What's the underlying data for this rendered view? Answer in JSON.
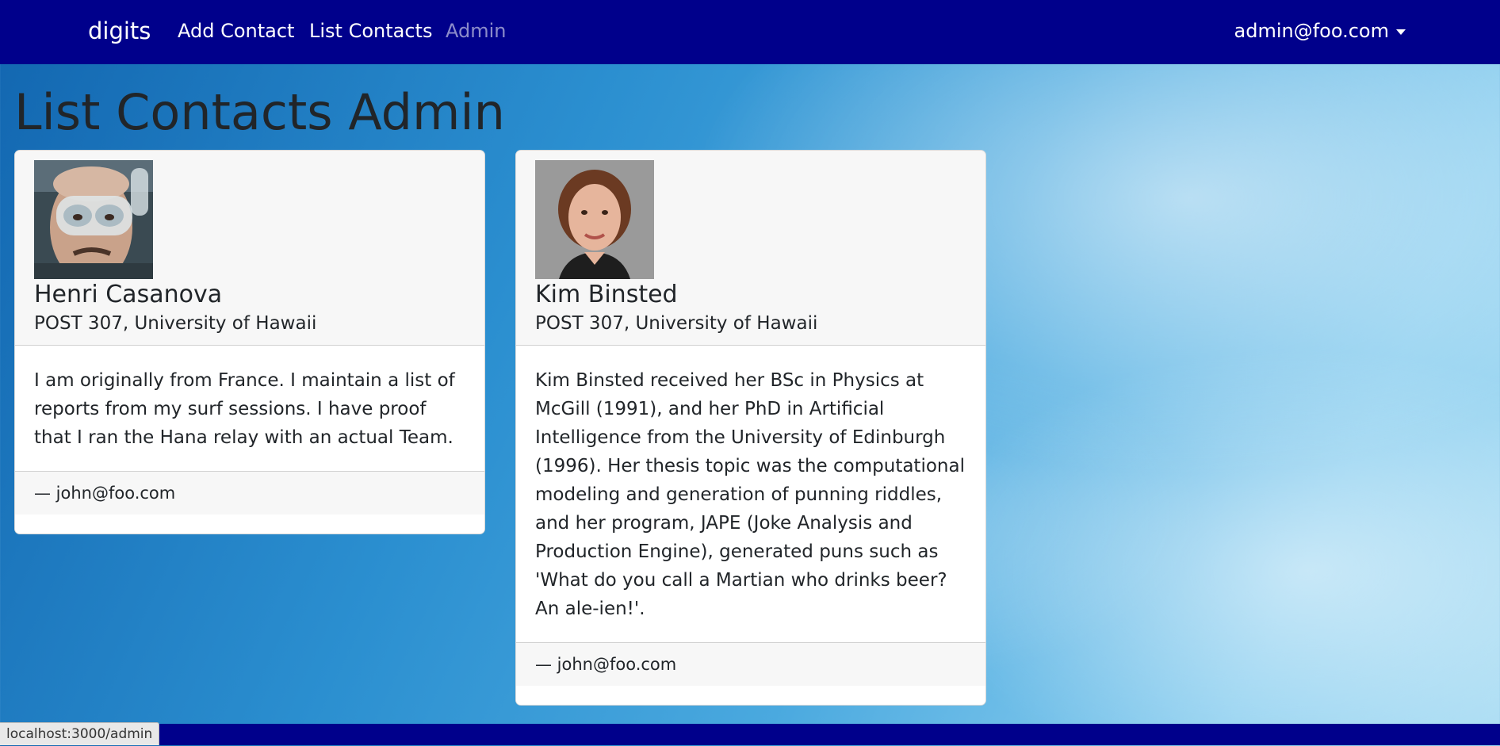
{
  "navbar": {
    "brand": "digits",
    "links": [
      {
        "label": "Add Contact"
      },
      {
        "label": "List Contacts"
      },
      {
        "label": "Admin"
      }
    ],
    "user": "admin@foo.com"
  },
  "page": {
    "title": "List Contacts Admin"
  },
  "contacts": [
    {
      "name": "Henri Casanova",
      "address": "POST 307, University of Hawaii",
      "description": "I am originally from France. I maintain a list of reports from my surf sessions. I have proof that I ran the Hana relay with an actual Team.",
      "owner": "— john@foo.com"
    },
    {
      "name": "Kim Binsted",
      "address": "POST 307, University of Hawaii",
      "description": "Kim Binsted received her BSc in Physics at McGill (1991), and her PhD in Artificial Intelligence from the University of Edinburgh (1996). Her thesis topic was the computational modeling and generation of punning riddles, and her program, JAPE (Joke Analysis and Production Engine), generated puns such as 'What do you call a Martian who drinks beer? An ale-ien!'.",
      "owner": "— john@foo.com"
    }
  ],
  "status_bar": {
    "url": "localhost:3000/admin"
  },
  "colors": {
    "navbar": "#00008b",
    "card_header": "#f7f7f7"
  }
}
